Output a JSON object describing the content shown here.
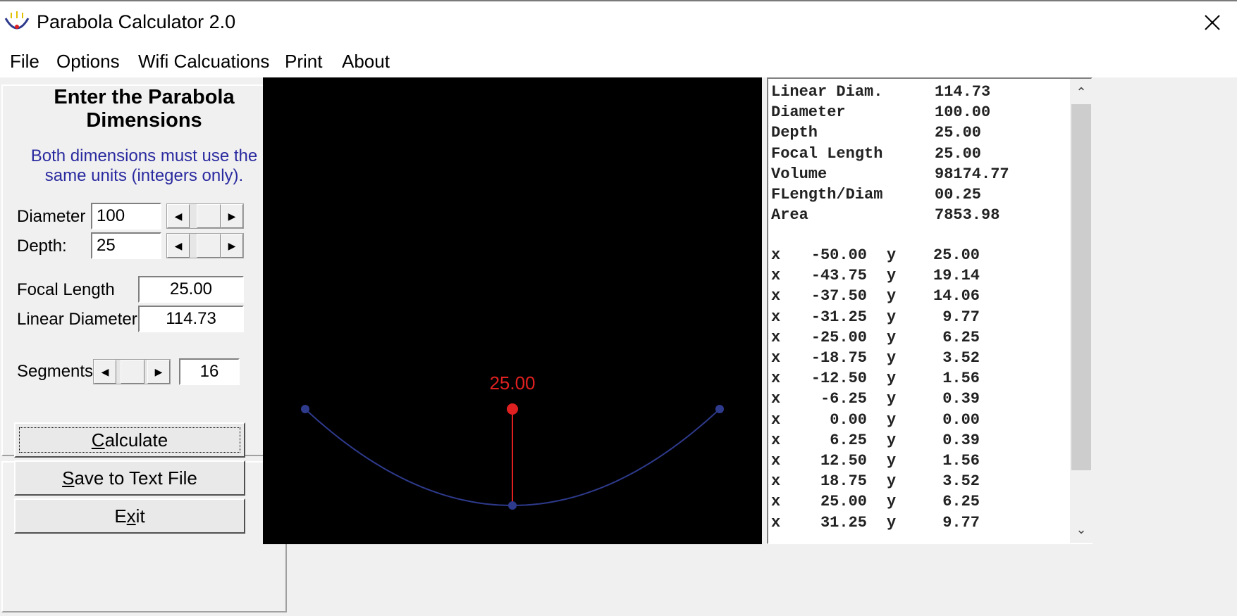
{
  "window": {
    "title": "Parabola Calculator 2.0",
    "close_glyph": "✕"
  },
  "menu": [
    "File",
    "Options",
    "Wifi Calcuations",
    "Print",
    "About"
  ],
  "input_panel": {
    "heading_line1": "Enter the Parabola",
    "heading_line2": "Dimensions",
    "note_line1": "Both dimensions must use the",
    "note_line2": "same units (integers only).",
    "diameter_label": "Diameter",
    "diameter_value": "100",
    "depth_label": "Depth:",
    "depth_value": "25",
    "focal_label": "Focal Length",
    "focal_value": "25.00",
    "linear_label": "Linear Diameter",
    "linear_value": "114.73",
    "segments_label": "Segments",
    "segments_value": "16"
  },
  "buttons": {
    "calculate_u": "C",
    "calculate_rest": "alculate",
    "save_u": "S",
    "save_rest": "ave to Text File",
    "exit_pre": "E",
    "exit_u": "x",
    "exit_rest": "it"
  },
  "canvas": {
    "focal_label": "25.00",
    "curve_color": "#2e3a8c",
    "focal_color": "#e02020",
    "diameter": 100,
    "depth": 25,
    "focal_length": 25
  },
  "results": {
    "summary": [
      {
        "label": "Linear Diam.",
        "value": "114.73"
      },
      {
        "label": "Diameter",
        "value": "100.00"
      },
      {
        "label": "Depth",
        "value": "25.00"
      },
      {
        "label": "Focal Length",
        "value": "25.00"
      },
      {
        "label": "Volume",
        "value": "98174.77"
      },
      {
        "label": "FLength/Diam",
        "value": "00.25"
      },
      {
        "label": "Area",
        "value": "7853.98"
      }
    ],
    "x_label": "x",
    "y_label": "y",
    "points": [
      {
        "x": "-50.00",
        "y": "25.00"
      },
      {
        "x": "-43.75",
        "y": "19.14"
      },
      {
        "x": "-37.50",
        "y": "14.06"
      },
      {
        "x": "-31.25",
        "y": "9.77"
      },
      {
        "x": "-25.00",
        "y": "6.25"
      },
      {
        "x": "-18.75",
        "y": "3.52"
      },
      {
        "x": "-12.50",
        "y": "1.56"
      },
      {
        "x": "-6.25",
        "y": "0.39"
      },
      {
        "x": "0.00",
        "y": "0.00"
      },
      {
        "x": "6.25",
        "y": "0.39"
      },
      {
        "x": "12.50",
        "y": "1.56"
      },
      {
        "x": "18.75",
        "y": "3.52"
      },
      {
        "x": "25.00",
        "y": "6.25"
      },
      {
        "x": "31.25",
        "y": "9.77"
      }
    ],
    "scroll_up": "⌃",
    "scroll_down": "⌄"
  }
}
